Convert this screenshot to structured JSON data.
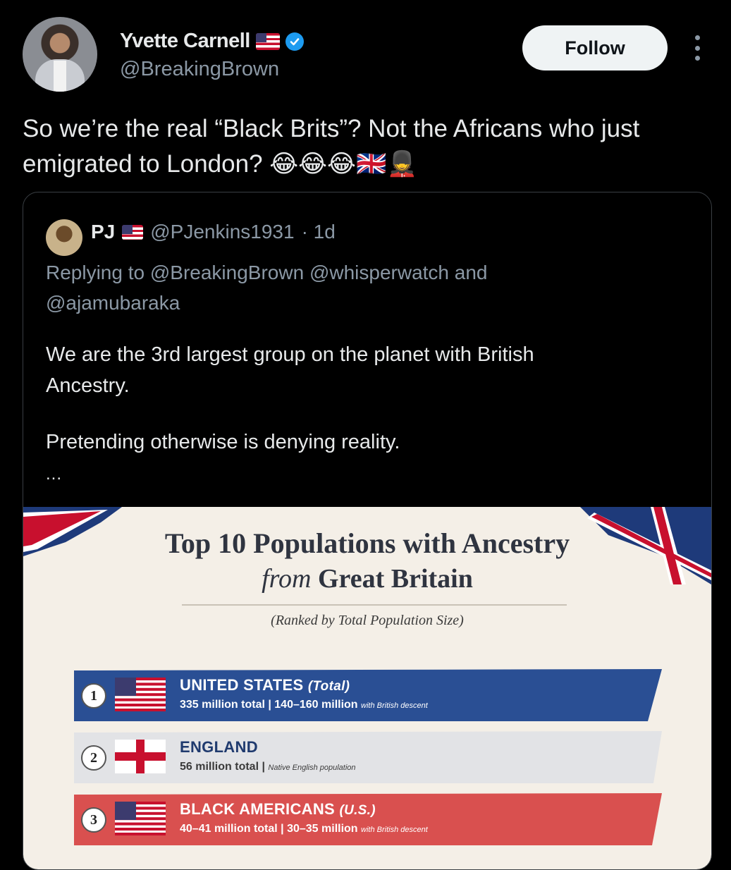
{
  "author": {
    "name": "Yvette Carnell",
    "flag_emoji": "🇺🇸",
    "handle": "@BreakingBrown",
    "verified": true
  },
  "follow_label": "Follow",
  "tweet": {
    "text": "So we’re the real “Black Brits”? Not the Africans who just emigrated to London? 😂😂😂🇬🇧💂"
  },
  "quote": {
    "name": "PJ",
    "flag_emoji": "🇺🇸",
    "handle": "@PJenkins1931",
    "time": "· 1d",
    "replying_line1": "Replying to @BreakingBrown @whisperwatch and",
    "replying_line2": "@ajamubaraka",
    "body_line1": "We are the 3rd largest group on the planet with British",
    "body_line2": "Ancestry.",
    "body_line3": "Pretending otherwise is denying reality.",
    "ellipsis": "..."
  },
  "infographic": {
    "title": "Top 10 Populations with Ancestry",
    "subtitle_italic": "from",
    "subtitle_bold": "Great Britain",
    "note": "(Ranked by Total Population Size)",
    "rows": [
      {
        "rank": "1",
        "title": "UNITED STATES",
        "suffix": "(Total)",
        "detail": "335 million total | 140–160 million",
        "detail_small": "with British descent",
        "color": "#2a4f94",
        "flag": "us"
      },
      {
        "rank": "2",
        "title": "ENGLAND",
        "suffix": "",
        "detail": "56 million total |",
        "detail_small": "Native English population",
        "color": "#e2e3e6",
        "flag": "england"
      },
      {
        "rank": "3",
        "title": "BLACK AMERICANS",
        "suffix": "(U.S.)",
        "detail": "40–41 million total | 30–35 million",
        "detail_small": "with British descent",
        "color": "#d9504f",
        "flag": "us"
      }
    ]
  }
}
